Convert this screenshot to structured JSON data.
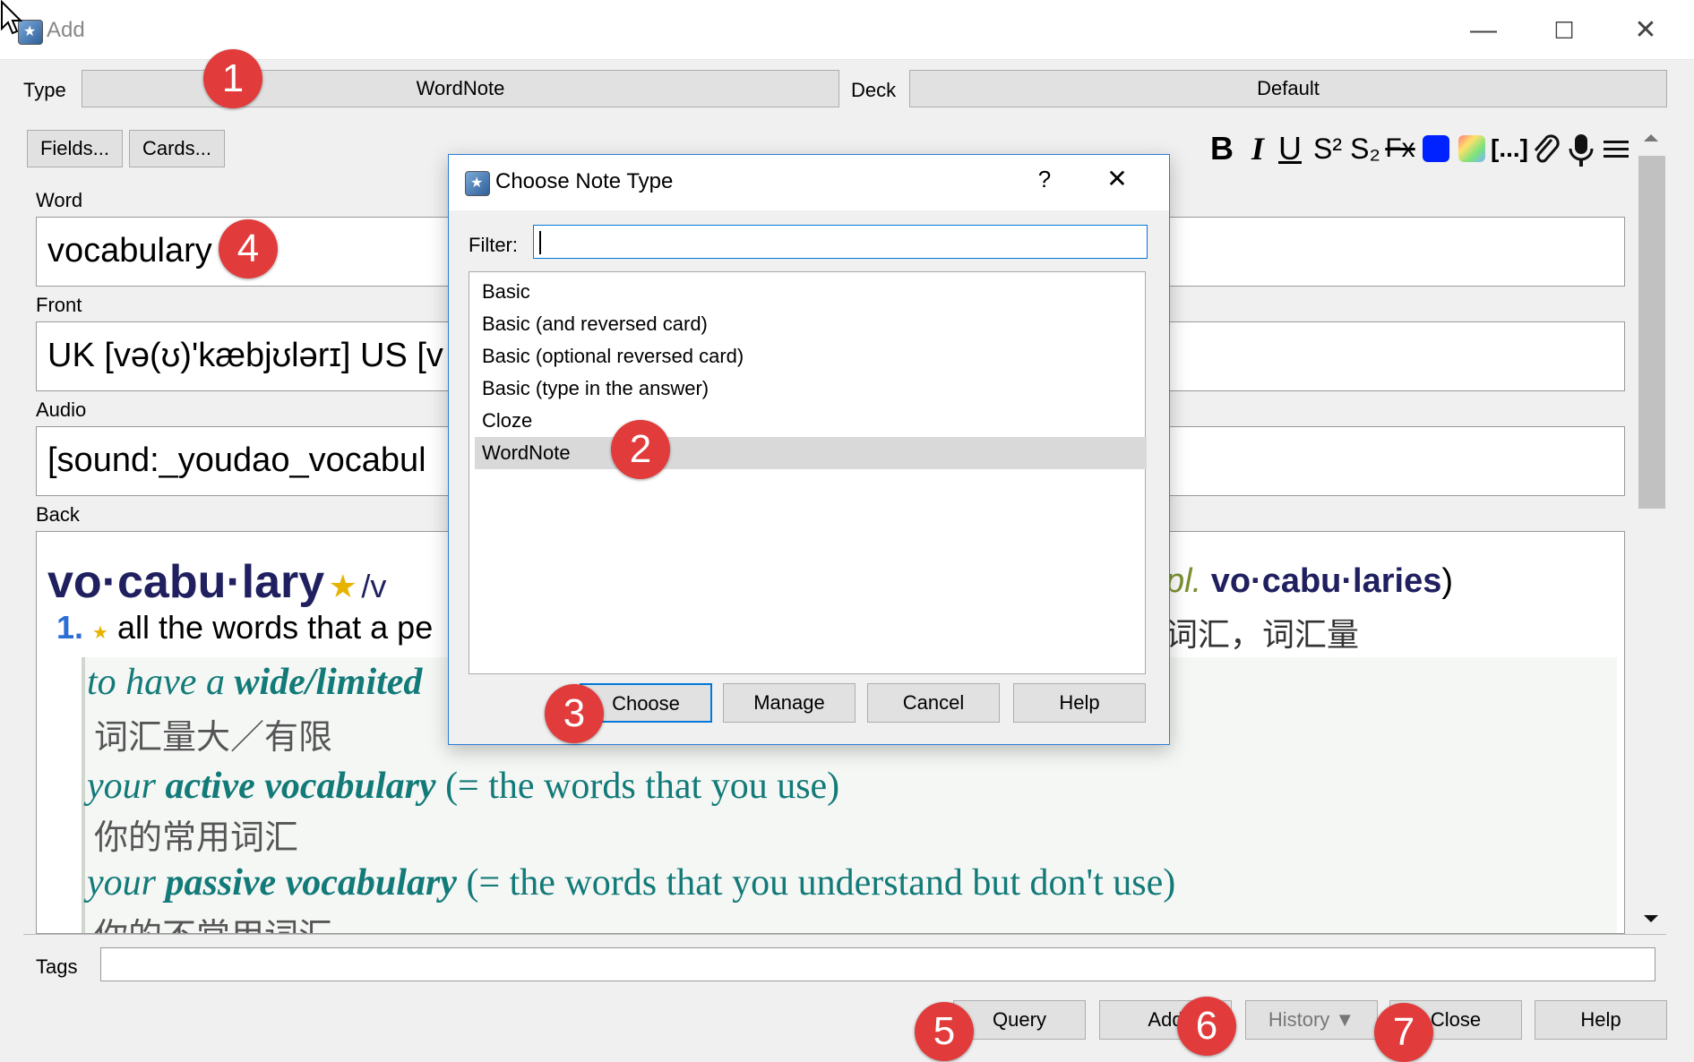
{
  "window": {
    "title": "Add",
    "minimize": "—",
    "maximize": "☐",
    "close": "✕"
  },
  "top": {
    "type_label": "Type",
    "type_value": "WordNote",
    "deck_label": "Deck",
    "deck_value": "Default"
  },
  "buttons": {
    "fields": "Fields...",
    "cards": "Cards..."
  },
  "toolbar": {
    "bold": "B",
    "italic": "I",
    "underline": "U",
    "superscript": "S²",
    "subscript": "S₂",
    "clear_format": "Fx",
    "cloze": "[...]",
    "color": "#0022ff"
  },
  "fields": [
    {
      "label": "Word",
      "value": "vocabulary"
    },
    {
      "label": "Front",
      "value": "UK [və(ʊ)'kæbjʊlərɪ] US [v"
    },
    {
      "label": "Audio",
      "value": "[sound:_youdao_vocabul"
    },
    {
      "label": "Back"
    }
  ],
  "back": {
    "headword": "vo·cabu·lary",
    "star": "★",
    "pron_start": "/v",
    "plural_abbr": "pl.",
    "plural_word": "vo·cabu·laries",
    "plural_close": ")",
    "sense_num": "1.",
    "sense_star": "★",
    "sense_text": "all the words that a pe",
    "sense_cn": "词汇，词汇量",
    "ex1_en_a": "to have a ",
    "ex1_en_b": "wide/limited",
    "ex1_cn": "词汇量大／有限",
    "ex2_a": "your ",
    "ex2_b": "active vocabulary",
    "ex2_c": " (= the words that you use)",
    "ex2_cn": "你的常用词汇",
    "ex3_a": "your ",
    "ex3_b": "passive vocabulary",
    "ex3_c": " (= the words that you understand but don't use)",
    "ex3_cn": "你的不常用词汇"
  },
  "tags": {
    "label": "Tags",
    "value": ""
  },
  "bottom_buttons": {
    "query": "Query",
    "add": "Add",
    "history": "History ▼",
    "close": "Close",
    "help": "Help"
  },
  "dialog": {
    "title": "Choose Note Type",
    "help_q": "?",
    "close": "✕",
    "filter_label": "Filter:",
    "filter_value": "",
    "items": [
      "Basic",
      "Basic (and reversed card)",
      "Basic (optional reversed card)",
      "Basic (type in the answer)",
      "Cloze",
      "WordNote"
    ],
    "selected": "WordNote",
    "buttons": {
      "choose": "Choose",
      "manage": "Manage",
      "cancel": "Cancel",
      "help": "Help"
    }
  },
  "markers": [
    "1",
    "2",
    "3",
    "4",
    "5",
    "6",
    "7"
  ]
}
